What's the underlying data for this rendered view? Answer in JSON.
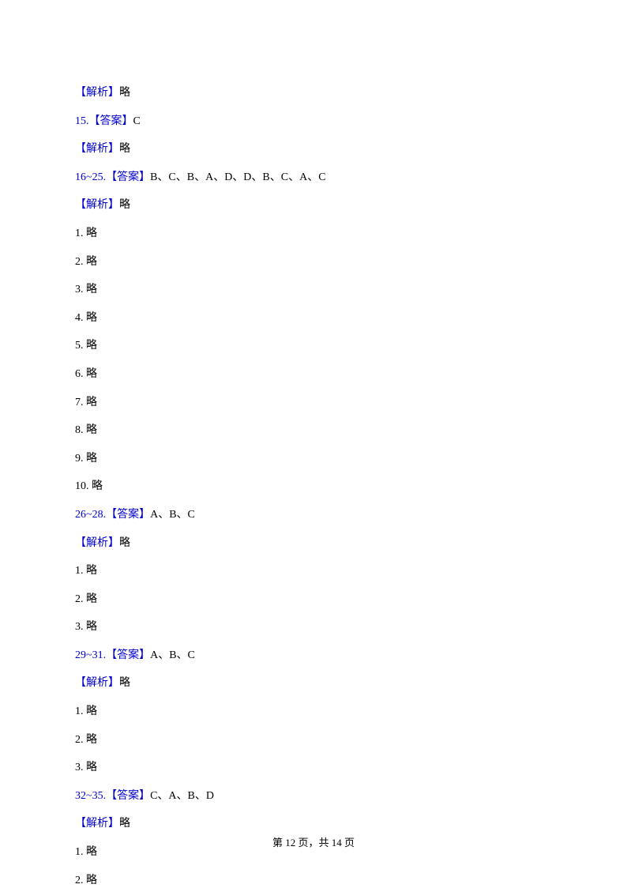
{
  "lines": [
    {
      "parts": [
        {
          "text": "【解析】",
          "blue": true
        },
        {
          "text": "略"
        }
      ]
    },
    {
      "parts": [
        {
          "text": "15.【答案】",
          "blue": true
        },
        {
          "text": "C"
        }
      ]
    },
    {
      "parts": [
        {
          "text": "【解析】",
          "blue": true
        },
        {
          "text": "略"
        }
      ]
    },
    {
      "parts": [
        {
          "text": "16~25.【答案】",
          "blue": true
        },
        {
          "text": "B、C、B、A、D、D、B、C、A、C"
        }
      ]
    },
    {
      "parts": [
        {
          "text": "【解析】",
          "blue": true
        },
        {
          "text": "略"
        }
      ]
    },
    {
      "parts": [
        {
          "text": "1. 略"
        }
      ]
    },
    {
      "parts": [
        {
          "text": "2. 略"
        }
      ]
    },
    {
      "parts": [
        {
          "text": "3. 略"
        }
      ]
    },
    {
      "parts": [
        {
          "text": "4. 略"
        }
      ]
    },
    {
      "parts": [
        {
          "text": "5. 略"
        }
      ]
    },
    {
      "parts": [
        {
          "text": "6. 略"
        }
      ]
    },
    {
      "parts": [
        {
          "text": "7. 略"
        }
      ]
    },
    {
      "parts": [
        {
          "text": "8. 略"
        }
      ]
    },
    {
      "parts": [
        {
          "text": "9. 略"
        }
      ]
    },
    {
      "parts": [
        {
          "text": "10. 略"
        }
      ]
    },
    {
      "parts": [
        {
          "text": "26~28.【答案】",
          "blue": true
        },
        {
          "text": "A、B、C"
        }
      ]
    },
    {
      "parts": [
        {
          "text": "【解析】",
          "blue": true
        },
        {
          "text": "略"
        }
      ]
    },
    {
      "parts": [
        {
          "text": "1. 略"
        }
      ]
    },
    {
      "parts": [
        {
          "text": "2. 略"
        }
      ]
    },
    {
      "parts": [
        {
          "text": "3. 略"
        }
      ]
    },
    {
      "parts": [
        {
          "text": "29~31.【答案】",
          "blue": true
        },
        {
          "text": "A、B、C"
        }
      ]
    },
    {
      "parts": [
        {
          "text": "【解析】",
          "blue": true
        },
        {
          "text": "略"
        }
      ]
    },
    {
      "parts": [
        {
          "text": "1. 略"
        }
      ]
    },
    {
      "parts": [
        {
          "text": "2. 略"
        }
      ]
    },
    {
      "parts": [
        {
          "text": "3. 略"
        }
      ]
    },
    {
      "parts": [
        {
          "text": "32~35.【答案】",
          "blue": true
        },
        {
          "text": "C、A、B、D"
        }
      ]
    },
    {
      "parts": [
        {
          "text": "【解析】",
          "blue": true
        },
        {
          "text": "略"
        }
      ]
    },
    {
      "parts": [
        {
          "text": "1. 略"
        }
      ]
    },
    {
      "parts": [
        {
          "text": "2. 略"
        }
      ]
    }
  ],
  "footer": "第 12 页，共 14 页"
}
